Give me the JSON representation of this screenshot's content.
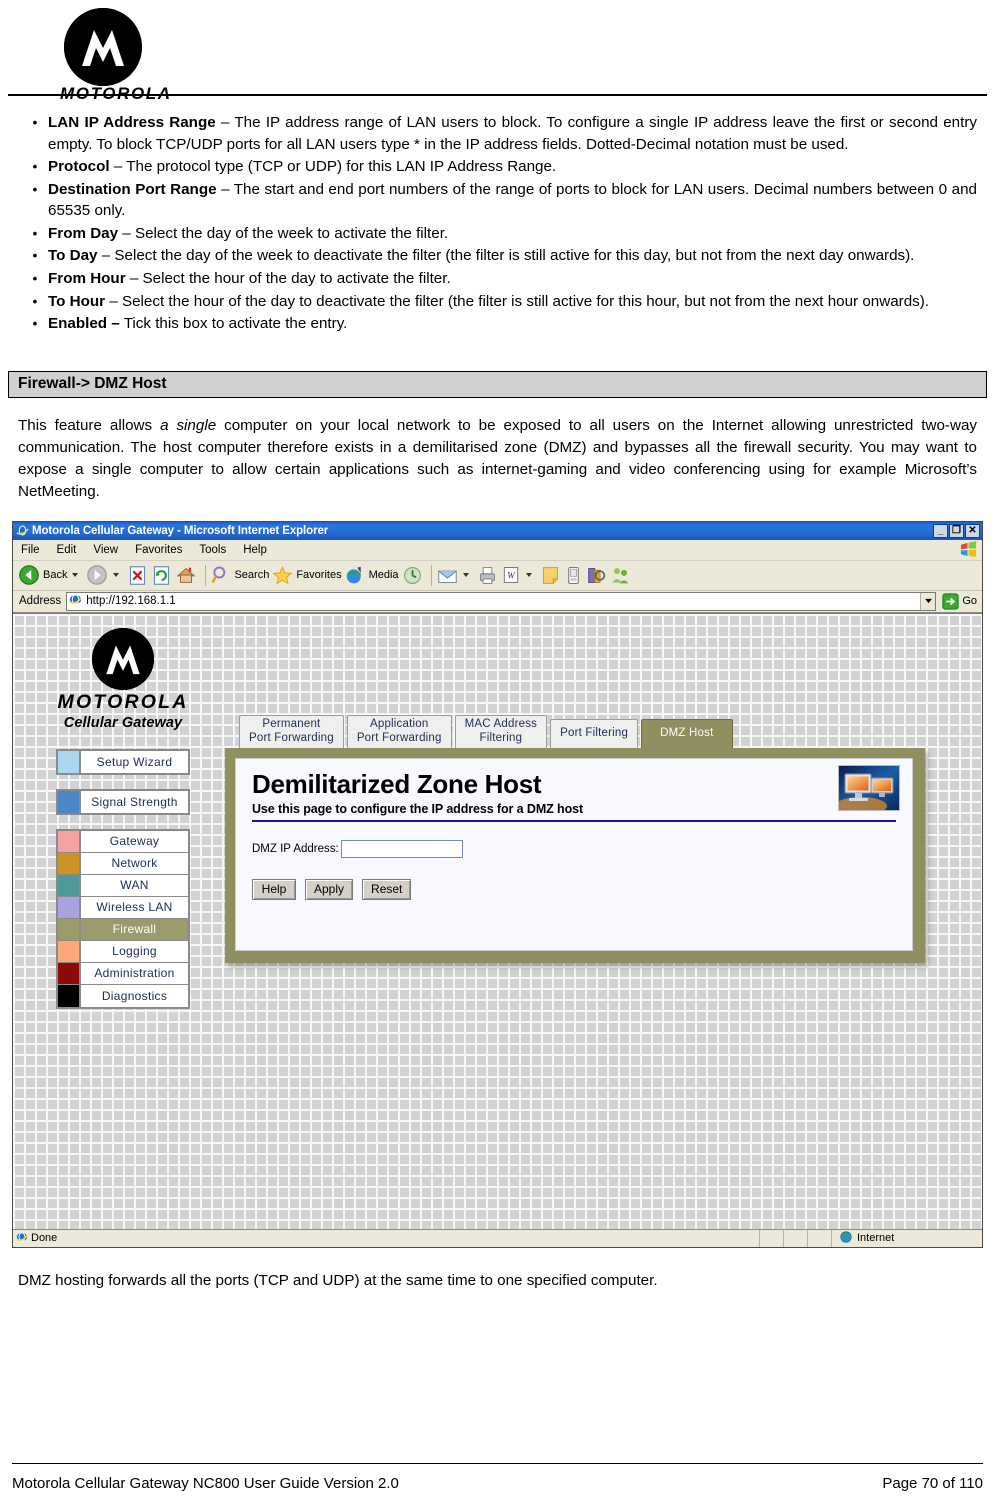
{
  "header": {
    "brand_wordmark": "MOTOROLA"
  },
  "bullets": [
    {
      "term": "LAN IP Address Range",
      "dash": " – ",
      "desc": "The IP address range of LAN users to block. To configure a single IP address leave the first or second entry empty. To block TCP/UDP ports for all LAN users type * in the IP address fields. Dotted-Decimal notation must be used."
    },
    {
      "term": "Protocol",
      "dash": " – ",
      "desc": "The protocol type (TCP or UDP) for this LAN IP Address Range."
    },
    {
      "term": "Destination Port Range",
      "dash": " – ",
      "desc": "The start and end port numbers of the range of ports to block for LAN users. Decimal numbers between 0 and 65535 only."
    },
    {
      "term": "From Day",
      "dash": " – ",
      "desc": "Select the day of the week to activate the filter."
    },
    {
      "term": "To Day",
      "dash": " – ",
      "desc": "Select the day of the week to deactivate the filter (the filter is still active for this day, but not from the next day onwards)."
    },
    {
      "term": "From Hour",
      "dash": " – ",
      "desc": "Select the hour of the day to activate the filter."
    },
    {
      "term": "To Hour",
      "dash": " – ",
      "desc": "Select the hour of the day to deactivate the filter (the filter is still active for this hour, but not from the next hour onwards)."
    },
    {
      "term": "Enabled –",
      "dash": " ",
      "desc": "Tick this box to activate the entry."
    }
  ],
  "section": {
    "heading": "Firewall-> DMZ Host",
    "intro_part1": "This feature allows ",
    "intro_italic": "a single",
    "intro_part2": " computer on your local network to be exposed to all users on the Internet allowing unrestricted two-way communication. The host computer therefore exists in a demilitarised zone (DMZ) and bypasses all the firewall security. You may want to expose a single computer to allow certain applications such as internet-gaming and video conferencing using for example Microsoft’s NetMeeting."
  },
  "browser": {
    "title": "Motorola Cellular Gateway - Microsoft Internet Explorer",
    "window_buttons": [
      "_",
      "❐",
      "✕"
    ],
    "menu": [
      "File",
      "Edit",
      "View",
      "Favorites",
      "Tools",
      "Help"
    ],
    "toolbar": {
      "back_label": "Back",
      "search_label": "Search",
      "favorites_label": "Favorites",
      "media_label": "Media",
      "icons": [
        "back-arrow-icon",
        "forward-arrow-icon",
        "stop-icon",
        "refresh-icon",
        "home-icon",
        "search-icon",
        "favorites-star-icon",
        "media-icon",
        "history-icon",
        "mail-icon",
        "print-icon",
        "edit-word-icon",
        "notes-icon",
        "messenger-device-icon",
        "research-icon",
        "people-icon"
      ]
    },
    "address": {
      "label": "Address",
      "value": "http://192.168.1.1",
      "go_label": "Go"
    },
    "status": {
      "text": "Done",
      "zone": "Internet"
    }
  },
  "gateway_ui": {
    "brand_wordmark": "MOTOROLA",
    "brand_subtitle": "Cellular Gateway",
    "nav_groups": [
      {
        "items": [
          {
            "label": "Setup Wizard",
            "swatch": "#aad7ef",
            "active": false
          }
        ]
      },
      {
        "items": [
          {
            "label": "Signal Strength",
            "swatch": "#4a87c4",
            "active": false
          }
        ]
      },
      {
        "items": [
          {
            "label": "Gateway",
            "swatch": "#f7a2a2",
            "active": false
          },
          {
            "label": "Network",
            "swatch": "#cc9522",
            "active": false
          },
          {
            "label": "WAN",
            "swatch": "#4f9a96",
            "active": false
          },
          {
            "label": "Wireless LAN",
            "swatch": "#a9a4e0",
            "active": false
          },
          {
            "label": "Firewall",
            "swatch": "#9a9a6a",
            "active": true
          },
          {
            "label": "Logging",
            "swatch": "#fca877",
            "active": false
          },
          {
            "label": "Administration",
            "swatch": "#8c0a0a",
            "active": false
          },
          {
            "label": "Diagnostics",
            "swatch": "#000000",
            "active": false
          }
        ]
      }
    ],
    "tabs": [
      {
        "line1": "Permanent",
        "line2": "Port Forwarding",
        "active": false
      },
      {
        "line1": "Application",
        "line2": "Port Forwarding",
        "active": false
      },
      {
        "line1": "MAC Address",
        "line2": "Filtering",
        "active": false
      },
      {
        "line1": "Port Filtering",
        "line2": "",
        "active": false
      },
      {
        "line1": "DMZ Host",
        "line2": "",
        "active": true
      }
    ],
    "panel": {
      "title": "Demilitarized Zone Host",
      "subtitle": "Use this page to configure the IP address for a DMZ host",
      "field_label": "DMZ IP Address:",
      "field_value": "",
      "buttons": [
        "Help",
        "Apply",
        "Reset"
      ]
    },
    "accent_color": "#8f8f5f"
  },
  "closing_text": "DMZ hosting forwards all the ports (TCP and UDP) at the same time to one specified computer.",
  "footer": {
    "left": "Motorola Cellular Gateway NC800 User Guide Version 2.0",
    "right": "Page 70 of 110"
  }
}
